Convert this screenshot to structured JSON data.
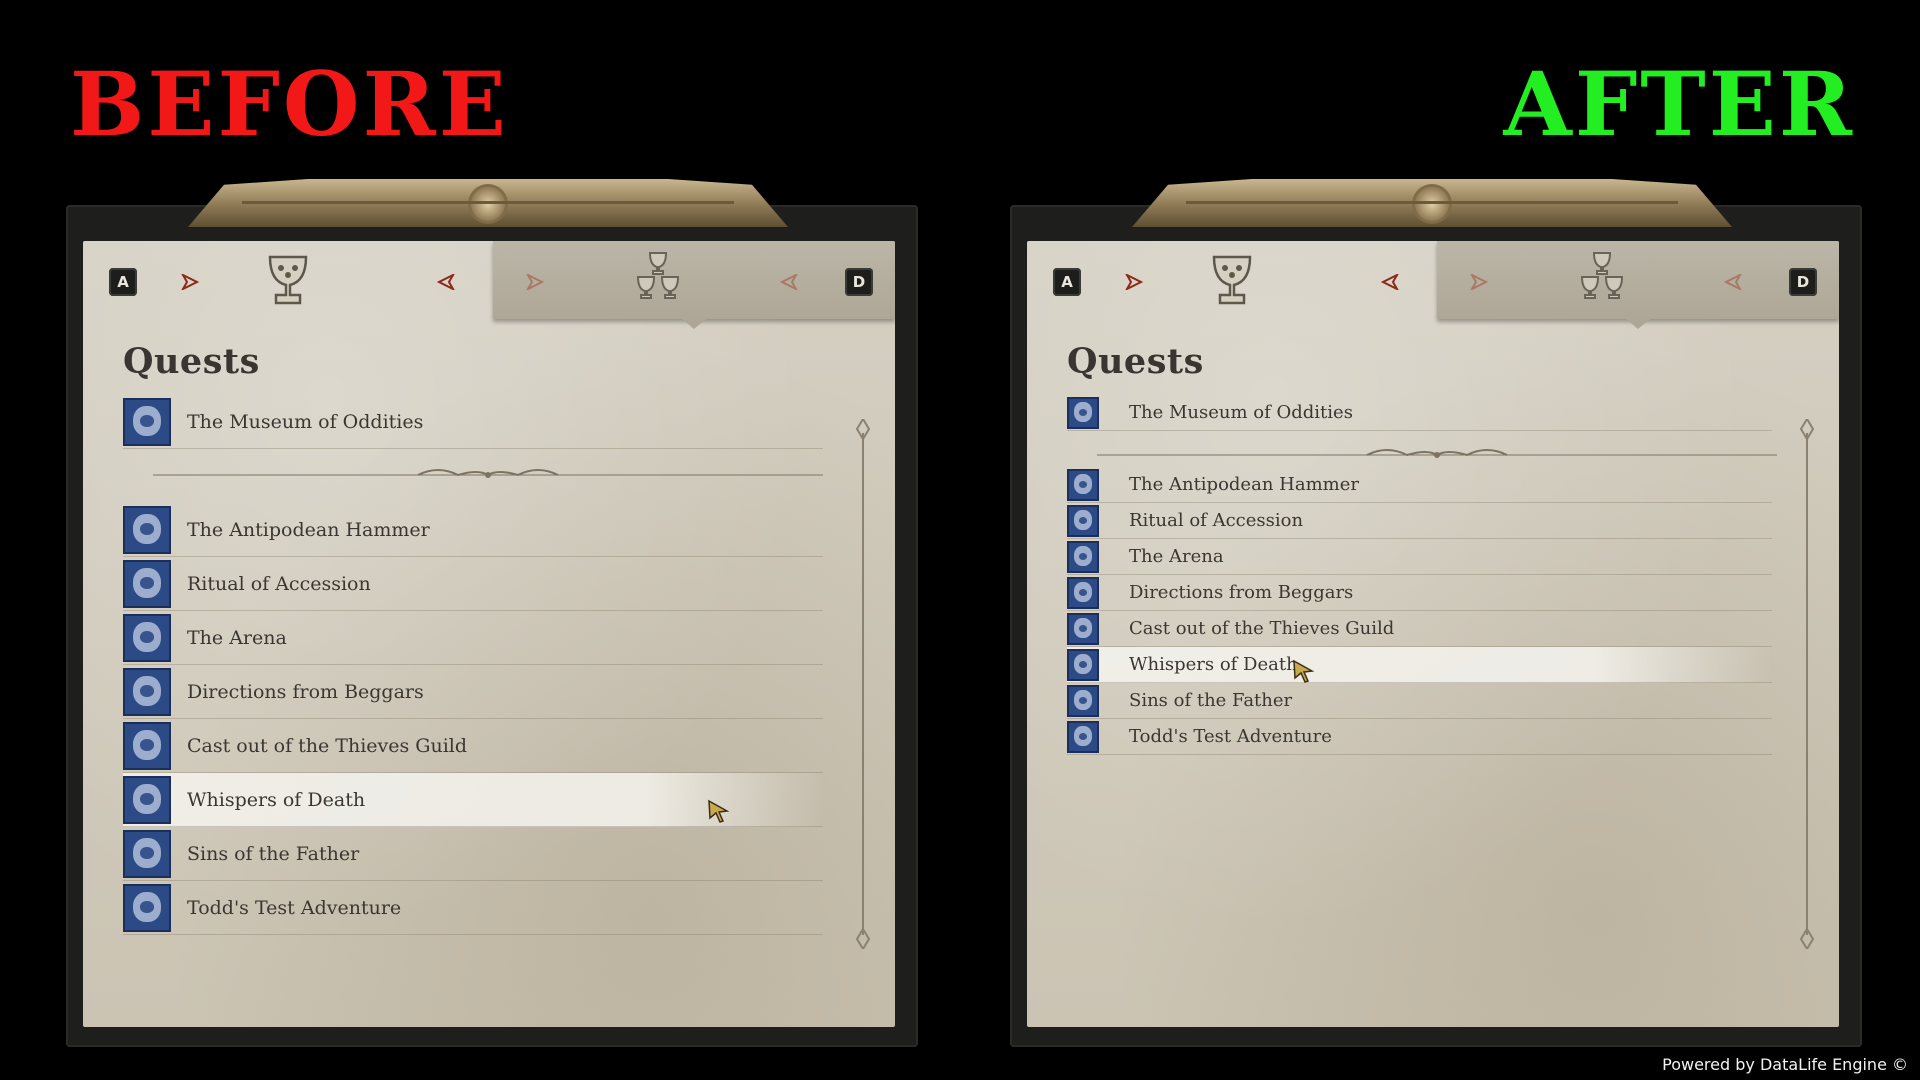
{
  "labels": {
    "before": "BEFORE",
    "after": "AFTER"
  },
  "tabs": {
    "prev_key": "A",
    "next_key": "D"
  },
  "quests_title": "Quests",
  "quests": [
    "The Museum of Oddities",
    "The Antipodean Hammer",
    "Ritual of Accession",
    "The Arena",
    "Directions from Beggars",
    "Cast out of the Thieves Guild",
    "Whispers of Death",
    "Sins of the Father",
    "Todd's Test Adventure"
  ],
  "selected_quest": "Whispers of Death",
  "footer": "Powered by DataLife Engine ©",
  "colors": {
    "before_label": "#f21818",
    "after_label": "#22ee22",
    "quest_icon": "#2c4a86"
  },
  "icons": {
    "tab_prev": "arrow-right-icon",
    "tab_next": "arrow-left-icon",
    "active_tab": "chalice-icon",
    "inactive_tab": "triple-chalice-icon",
    "pointer": "cursor-icon"
  }
}
